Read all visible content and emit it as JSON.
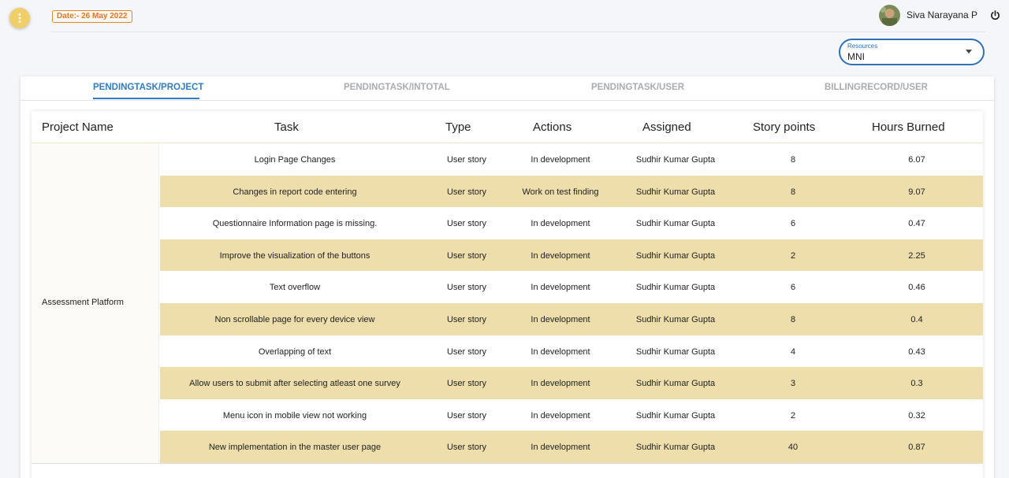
{
  "header": {
    "date_badge": "Date:- 26 May 2022",
    "user_name": "Siva Narayana P"
  },
  "resources": {
    "label": "Resources",
    "value": "MNI"
  },
  "tabs": [
    {
      "label": "PENDINGTASK/PROJECT",
      "active": true
    },
    {
      "label": "PENDINGTASK/INTOTAL",
      "active": false
    },
    {
      "label": "PENDINGTASK/USER",
      "active": false
    },
    {
      "label": "BILLINGRECORD/USER",
      "active": false
    }
  ],
  "table": {
    "columns": [
      "Project Name",
      "Task",
      "Type",
      "Actions",
      "Assigned",
      "Story points",
      "Hours Burned"
    ],
    "project_name": "Assessment Platform",
    "rows": [
      {
        "task": "Login Page Changes",
        "type": "User story",
        "action": "In development",
        "assigned": "Sudhir Kumar Gupta",
        "points": "8",
        "hours": "6.07"
      },
      {
        "task": "Changes in report code entering",
        "type": "User story",
        "action": "Work on test finding",
        "assigned": "Sudhir Kumar Gupta",
        "points": "8",
        "hours": "9.07"
      },
      {
        "task": "Questionnaire Information page is missing.",
        "type": "User story",
        "action": "In development",
        "assigned": "Sudhir Kumar Gupta",
        "points": "6",
        "hours": "0.47"
      },
      {
        "task": "Improve the visualization of the buttons",
        "type": "User story",
        "action": "In development",
        "assigned": "Sudhir Kumar Gupta",
        "points": "2",
        "hours": "2.25"
      },
      {
        "task": "Text overflow",
        "type": "User story",
        "action": "In development",
        "assigned": "Sudhir Kumar Gupta",
        "points": "6",
        "hours": "0.46"
      },
      {
        "task": "Non scrollable page for every device view",
        "type": "User story",
        "action": "In development",
        "assigned": "Sudhir Kumar Gupta",
        "points": "8",
        "hours": "0.4"
      },
      {
        "task": "Overlapping of text",
        "type": "User story",
        "action": "In development",
        "assigned": "Sudhir Kumar Gupta",
        "points": "4",
        "hours": "0.43"
      },
      {
        "task": "Allow users to submit after selecting atleast one survey",
        "type": "User story",
        "action": "In development",
        "assigned": "Sudhir Kumar Gupta",
        "points": "3",
        "hours": "0.3"
      },
      {
        "task": "Menu icon in mobile view not working",
        "type": "User story",
        "action": "In development",
        "assigned": "Sudhir Kumar Gupta",
        "points": "2",
        "hours": "0.32"
      },
      {
        "task": "New implementation in the master user page",
        "type": "User story",
        "action": "In development",
        "assigned": "Sudhir Kumar Gupta",
        "points": "40",
        "hours": "0.87"
      }
    ]
  },
  "colors": {
    "accent": "#2f7dc3",
    "row_highlight": "#eddeac",
    "menu_button": "#f0cf68",
    "date_badge": "#e0782d"
  },
  "icons": {
    "menu": "more-vert-icon",
    "power": "power-icon",
    "dropdown": "caret-down-icon"
  }
}
